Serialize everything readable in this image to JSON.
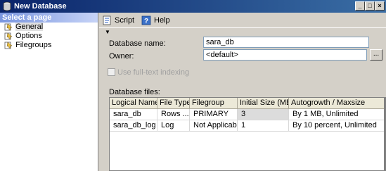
{
  "window": {
    "title": "New Database"
  },
  "left_pane": {
    "header": "Select a page",
    "items": [
      {
        "label": "General",
        "icon": "page-icon"
      },
      {
        "label": "Options",
        "icon": "page-icon"
      },
      {
        "label": "Filegroups",
        "icon": "page-icon"
      }
    ]
  },
  "toolbar": {
    "script_label": "Script",
    "help_label": "Help"
  },
  "form": {
    "db_name_label": "Database name:",
    "db_name_value": "sara_db",
    "owner_label": "Owner:",
    "owner_value": "<default>",
    "browse_label": "...",
    "fulltext_label": "Use full-text indexing",
    "files_label": "Database files:"
  },
  "files_table": {
    "columns": [
      "Logical Name",
      "File Type",
      "Filegroup",
      "Initial Size (MB)",
      "Autogrowth / Maxsize"
    ],
    "rows": [
      [
        "sara_db",
        "Rows ...",
        "PRIMARY",
        "3",
        "By 1 MB, Unlimited"
      ],
      [
        "sara_db_log",
        "Log",
        "Not Applicable",
        "1",
        "By 10 percent, Unlimited"
      ]
    ]
  }
}
